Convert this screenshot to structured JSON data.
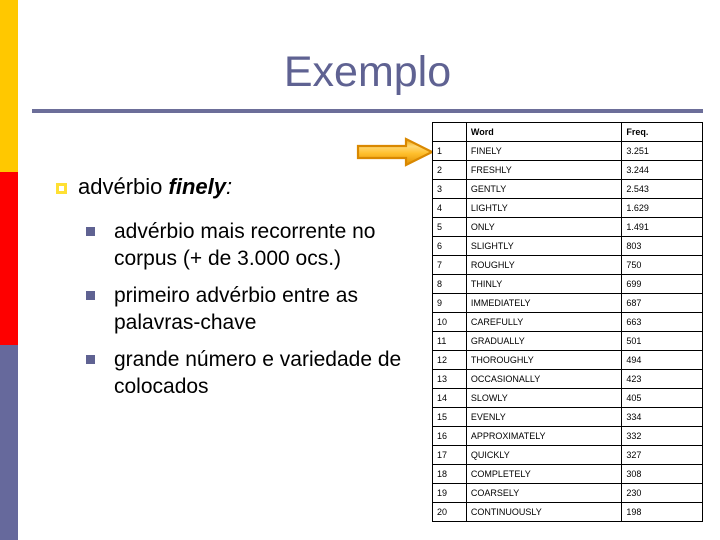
{
  "slide": {
    "title": "Exemplo",
    "title_color": "#5f6292",
    "rule_color": "#6c6e99"
  },
  "sidebar": {
    "bars": [
      {
        "name": "yellow-bar",
        "color": "#ffc800"
      },
      {
        "name": "red-bar",
        "color": "#fe0000"
      },
      {
        "name": "purple-bar",
        "color": "#66699c"
      }
    ]
  },
  "arrow": {
    "icon": "right-arrow-icon",
    "fill": "#ffb510",
    "highlight": "#ffd466",
    "stroke": "#d98800"
  },
  "body": {
    "bullet_main_prefix": "advérbio ",
    "bullet_main_emph": "finely",
    "bullet_main_suffix": ":",
    "marker_l1_color": "#ffe033",
    "marker_l2_color": "#5f6292",
    "subbullets": [
      "advérbio mais recorrente no corpus (+ de 3.000 ocs.)",
      "primeiro advérbio entre as palavras-chave",
      "grande número e variedade de colocados"
    ]
  },
  "table": {
    "headers": [
      "",
      "Word",
      "Freq."
    ],
    "rows": [
      {
        "rank": "1",
        "word": "FINELY",
        "freq": "3.251"
      },
      {
        "rank": "2",
        "word": "FRESHLY",
        "freq": "3.244"
      },
      {
        "rank": "3",
        "word": "GENTLY",
        "freq": "2.543"
      },
      {
        "rank": "4",
        "word": "LIGHTLY",
        "freq": "1.629"
      },
      {
        "rank": "5",
        "word": "ONLY",
        "freq": "1.491"
      },
      {
        "rank": "6",
        "word": "SLIGHTLY",
        "freq": "803"
      },
      {
        "rank": "7",
        "word": "ROUGHLY",
        "freq": "750"
      },
      {
        "rank": "8",
        "word": "THINLY",
        "freq": "699"
      },
      {
        "rank": "9",
        "word": "IMMEDIATELY",
        "freq": "687"
      },
      {
        "rank": "10",
        "word": "CAREFULLY",
        "freq": "663"
      },
      {
        "rank": "11",
        "word": "GRADUALLY",
        "freq": "501"
      },
      {
        "rank": "12",
        "word": "THOROUGHLY",
        "freq": "494"
      },
      {
        "rank": "13",
        "word": "OCCASIONALLY",
        "freq": "423"
      },
      {
        "rank": "14",
        "word": "SLOWLY",
        "freq": "405"
      },
      {
        "rank": "15",
        "word": "EVENLY",
        "freq": "334"
      },
      {
        "rank": "16",
        "word": "APPROXIMATELY",
        "freq": "332"
      },
      {
        "rank": "17",
        "word": "QUICKLY",
        "freq": "327"
      },
      {
        "rank": "18",
        "word": "COMPLETELY",
        "freq": "308"
      },
      {
        "rank": "19",
        "word": "COARSELY",
        "freq": "230"
      },
      {
        "rank": "20",
        "word": "CONTINUOUSLY",
        "freq": "198"
      }
    ]
  }
}
